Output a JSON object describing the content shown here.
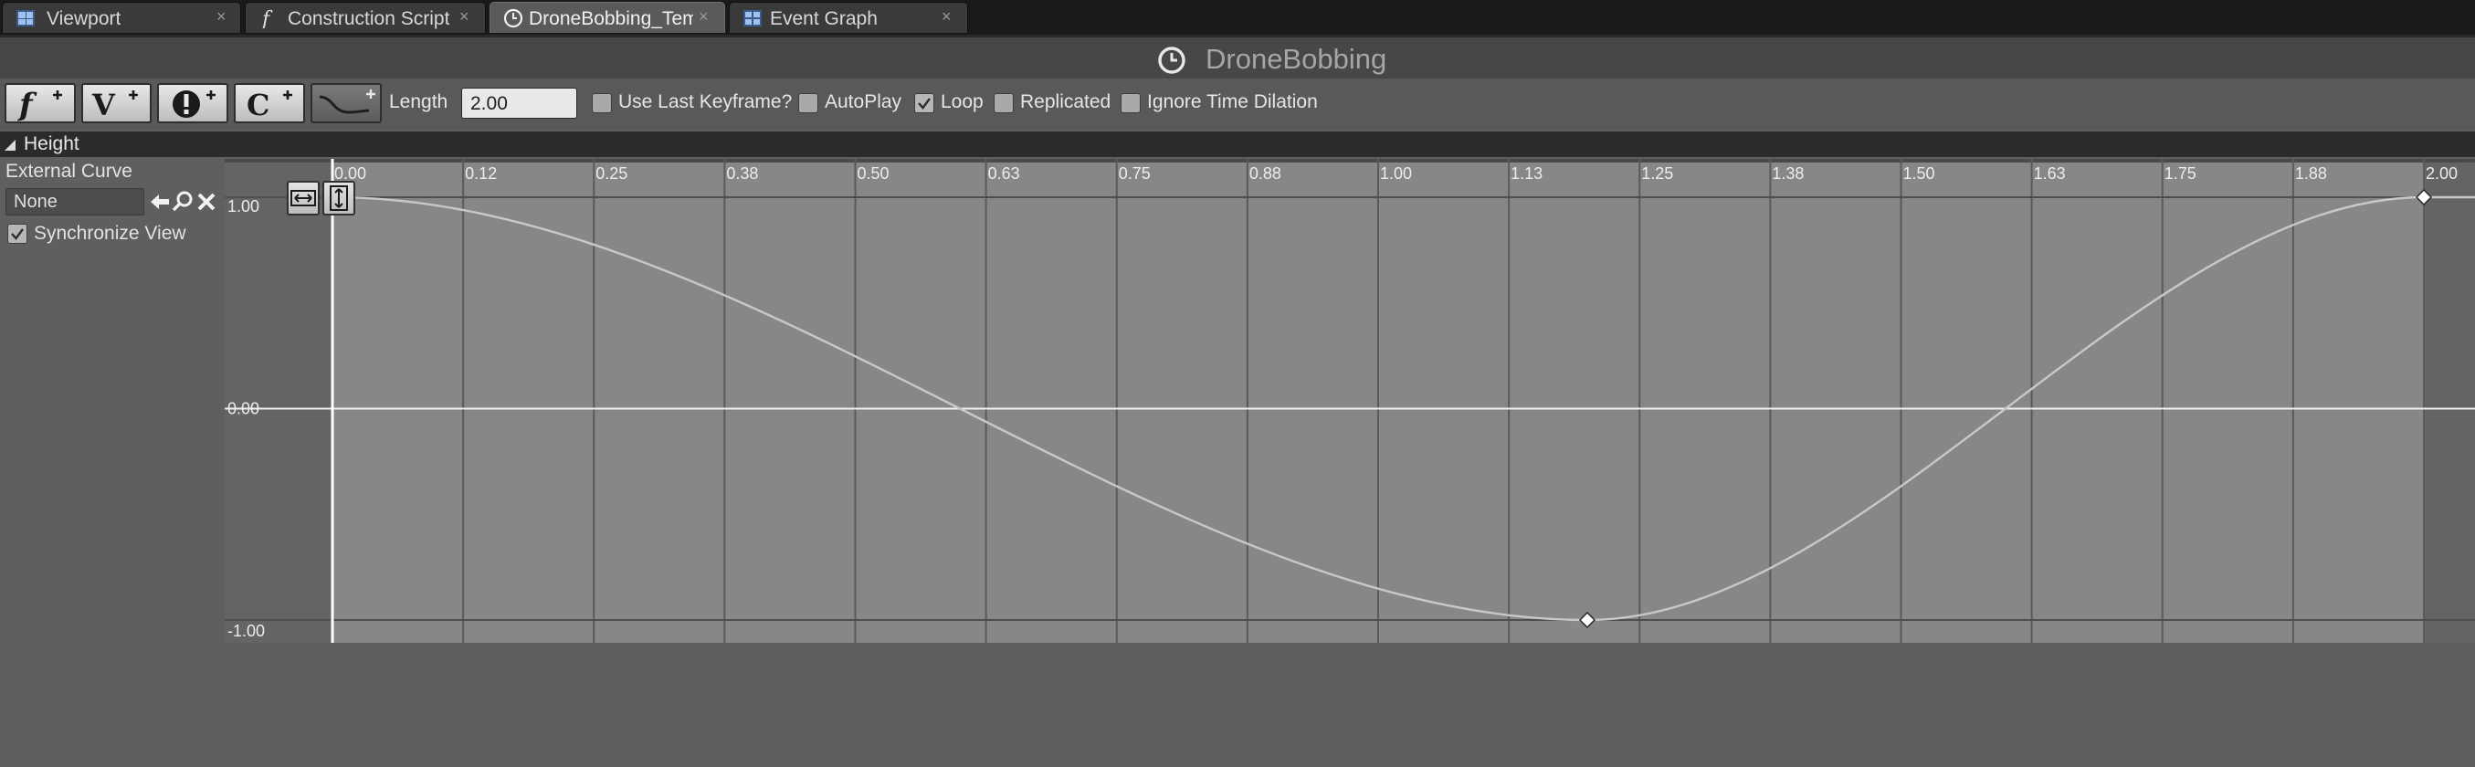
{
  "tabs": [
    {
      "label": "Viewport",
      "icon": "viewport-icon",
      "active": false
    },
    {
      "label": "Construction Script",
      "icon": "function-icon",
      "active": false
    },
    {
      "label": "DroneBobbing_Tem",
      "icon": "timeline-clock-icon",
      "active": true
    },
    {
      "label": "Event Graph",
      "icon": "graph-icon",
      "active": false
    }
  ],
  "tab_close_glyph": "×",
  "title_bar": {
    "title": "DroneBobbing",
    "icon": "clock-icon"
  },
  "toolbar": {
    "buttons": [
      {
        "icon": "add-float-track-icon",
        "glyph": "f"
      },
      {
        "icon": "add-vector-track-icon",
        "glyph": "V"
      },
      {
        "icon": "add-event-track-icon",
        "glyph": "!"
      },
      {
        "icon": "add-color-track-icon",
        "glyph": "C"
      },
      {
        "icon": "add-external-curve-icon",
        "glyph": ""
      }
    ],
    "length_label": "Length",
    "length_value": "2.00",
    "options": [
      {
        "label": "Use Last Keyframe?",
        "checked": false
      },
      {
        "label": "AutoPlay",
        "checked": false
      },
      {
        "label": "Loop",
        "checked": true
      },
      {
        "label": "Replicated",
        "checked": false
      },
      {
        "label": "Ignore Time Dilation",
        "checked": false
      }
    ]
  },
  "track": {
    "name": "Height",
    "external_curve_label": "External Curve",
    "external_curve_value": "None",
    "sync_view_label": "Synchronize View",
    "sync_view_checked": true
  },
  "curve_editor": {
    "time_ticks": [
      "0.00",
      "0.12",
      "0.25",
      "0.38",
      "0.50",
      "0.63",
      "0.75",
      "0.88",
      "1.00",
      "1.13",
      "1.25",
      "1.38",
      "1.50",
      "1.63",
      "1.75",
      "1.88",
      "2.00"
    ],
    "value_ticks": [
      "1.00",
      "0.00",
      "-1.00"
    ],
    "time_range": [
      0.0,
      2.0
    ],
    "value_range": [
      -1.0,
      1.0
    ],
    "keyframes": [
      {
        "time": 0.0,
        "value": 1.0
      },
      {
        "time": 1.2,
        "value": -1.0
      },
      {
        "time": 2.0,
        "value": 1.0
      }
    ],
    "zoom_buttons": [
      "fit-horizontal-icon",
      "fit-vertical-icon"
    ],
    "colors": {
      "curve": "#c8c8c8",
      "active_area": "#878787",
      "inactive_area": "#646464",
      "playhead": "#ffffff"
    }
  }
}
